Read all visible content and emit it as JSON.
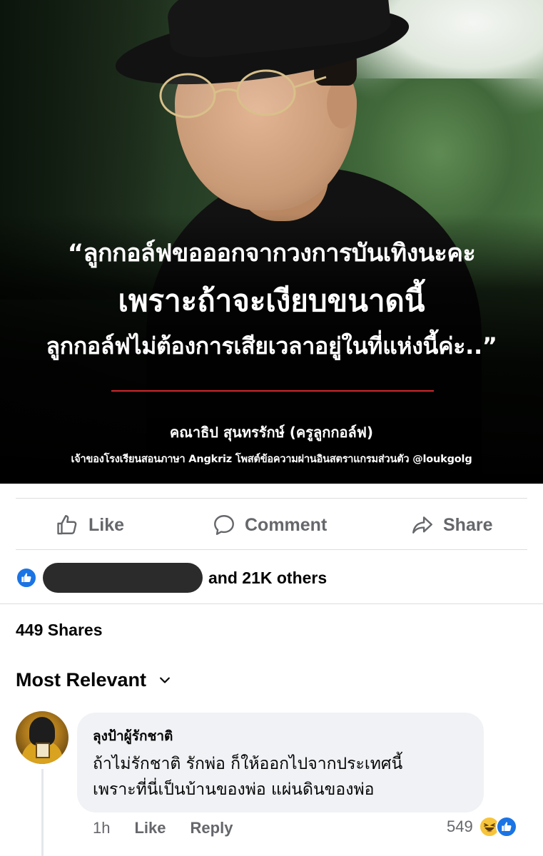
{
  "post": {
    "quote_line1": "“ลูกกอล์ฟขอออกจากวงการบันเทิงนะคะ",
    "quote_line2": "เพราะถ้าจะเงียบขนาดนี้",
    "quote_line3": "ลูกกอล์ฟไม่ต้องการเสียเวลาอยู่ในที่แห่งนี้ค่ะ..”",
    "author": "คณาธิป สุนทรรักษ์ (ครูลูกกอล์ฟ)",
    "caption": "เจ้าของโรงเรียนสอนภาษา Angkriz โพสต์ข้อความผ่านอินสตราแกรมส่วนตัว @loukgolg",
    "accent_color": "#d1272b"
  },
  "actions": {
    "like_label": "Like",
    "comment_label": "Comment",
    "share_label": "Share"
  },
  "reactions": {
    "text": "and 21K others",
    "icon": "like-icon"
  },
  "shares": "449 Shares",
  "sort": {
    "label": "Most Relevant",
    "icon": "chevron-down-icon"
  },
  "comment": {
    "author": "ลุงป้าผู้รักชาติ",
    "line1": "ถ้าไม่รักชาติ รักพ่อ ก็ให้ออกไปจากประเทศนี้",
    "line2": "เพราะที่นี่เป็นบ้านของพ่อ แผ่นดินของพ่อ",
    "time": "1h",
    "like_label": "Like",
    "reply_label": "Reply",
    "reaction_count": "549",
    "reaction_icons": [
      "haha-icon",
      "like-icon"
    ]
  },
  "colors": {
    "facebook_blue": "#1b74e4",
    "secondary_text": "#65676b",
    "bubble_bg": "#f0f2f5"
  }
}
